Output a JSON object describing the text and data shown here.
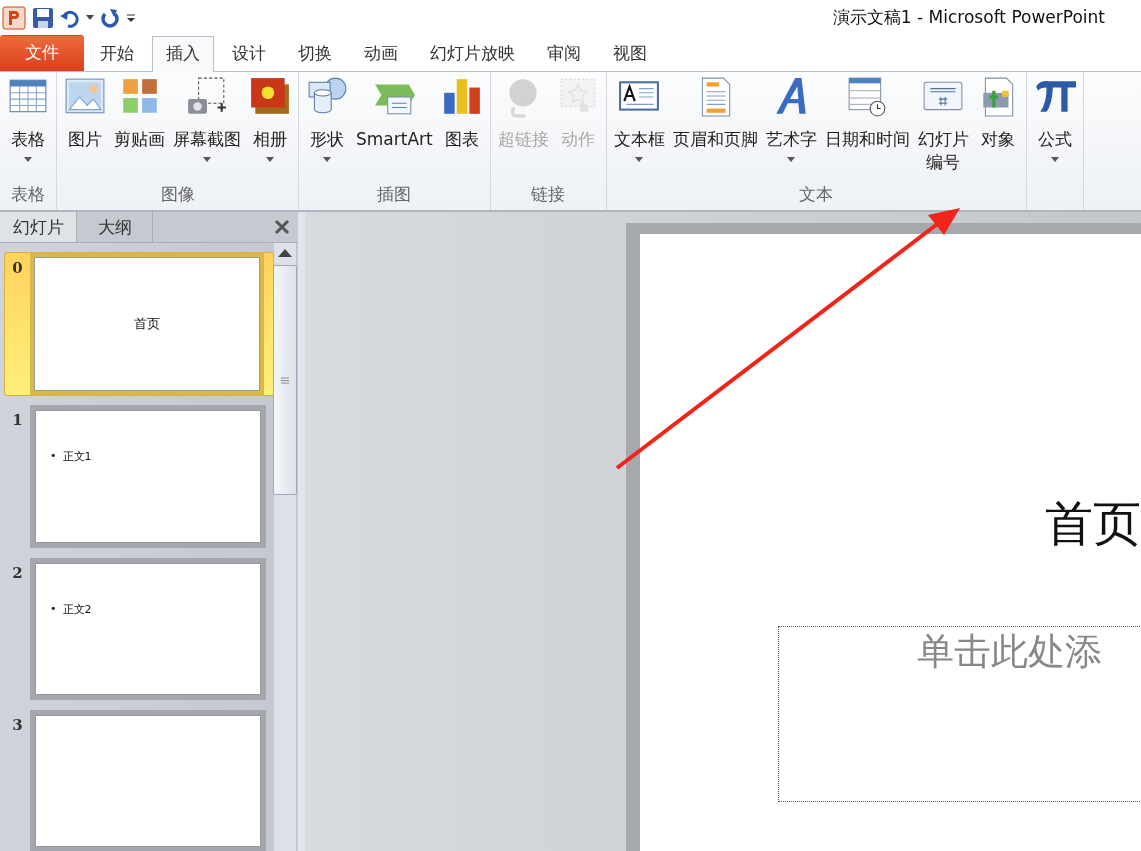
{
  "window": {
    "title": "演示文稿1 - Microsoft PowerPoint"
  },
  "tabs": [
    {
      "label": "文件",
      "kind": "file",
      "selected": false
    },
    {
      "label": "开始",
      "kind": "tab",
      "selected": false
    },
    {
      "label": "插入",
      "kind": "tab",
      "selected": true
    },
    {
      "label": "设计",
      "kind": "tab",
      "selected": false
    },
    {
      "label": "切换",
      "kind": "tab",
      "selected": false
    },
    {
      "label": "动画",
      "kind": "tab",
      "selected": false
    },
    {
      "label": "幻灯片放映",
      "kind": "tab",
      "selected": false
    },
    {
      "label": "审阅",
      "kind": "tab",
      "selected": false
    },
    {
      "label": "视图",
      "kind": "tab",
      "selected": false
    }
  ],
  "ribbon": [
    {
      "label": "表格",
      "items": [
        {
          "label": "表格",
          "dropdown": true,
          "disabled": false
        }
      ]
    },
    {
      "label": "图像",
      "items": [
        {
          "label": "图片",
          "dropdown": false,
          "disabled": false
        },
        {
          "label": "剪贴画",
          "dropdown": false,
          "disabled": false
        },
        {
          "label": "屏幕截图",
          "dropdown": true,
          "disabled": false
        },
        {
          "label": "相册",
          "dropdown": true,
          "disabled": false
        }
      ]
    },
    {
      "label": "插图",
      "items": [
        {
          "label": "形状",
          "dropdown": true,
          "disabled": false
        },
        {
          "label": "SmartArt",
          "dropdown": false,
          "disabled": false
        },
        {
          "label": "图表",
          "dropdown": false,
          "disabled": false
        }
      ]
    },
    {
      "label": "链接",
      "items": [
        {
          "label": "超链接",
          "dropdown": false,
          "disabled": true
        },
        {
          "label": "动作",
          "dropdown": false,
          "disabled": true
        }
      ]
    },
    {
      "label": "文本",
      "items": [
        {
          "label": "文本框",
          "dropdown": true,
          "disabled": false
        },
        {
          "label": "页眉和页脚",
          "dropdown": false,
          "disabled": false
        },
        {
          "label": "艺术字",
          "dropdown": true,
          "disabled": false
        },
        {
          "label": "日期和时间",
          "dropdown": false,
          "disabled": false
        },
        {
          "lines": [
            "幻灯片",
            "编号"
          ],
          "dropdown": false,
          "disabled": false
        },
        {
          "label": "对象",
          "dropdown": false,
          "disabled": false
        }
      ]
    },
    {
      "items": [
        {
          "label": "公式",
          "dropdown": true,
          "disabled": false
        }
      ]
    }
  ],
  "panel": {
    "tabs": [
      {
        "label": "幻灯片",
        "selected": true
      },
      {
        "label": "大纲",
        "selected": false
      }
    ],
    "slides": [
      {
        "number": "0",
        "kind": "title",
        "text": "首页",
        "selected": true
      },
      {
        "number": "1",
        "kind": "bullet",
        "bullet": "•",
        "text": "正文1",
        "selected": false
      },
      {
        "number": "2",
        "kind": "bullet",
        "bullet": "•",
        "text": "正文2",
        "selected": false
      },
      {
        "number": "3",
        "kind": "blank",
        "selected": false
      }
    ]
  },
  "slide": {
    "title": "首页",
    "subtitle_placeholder": "单击此处添"
  }
}
